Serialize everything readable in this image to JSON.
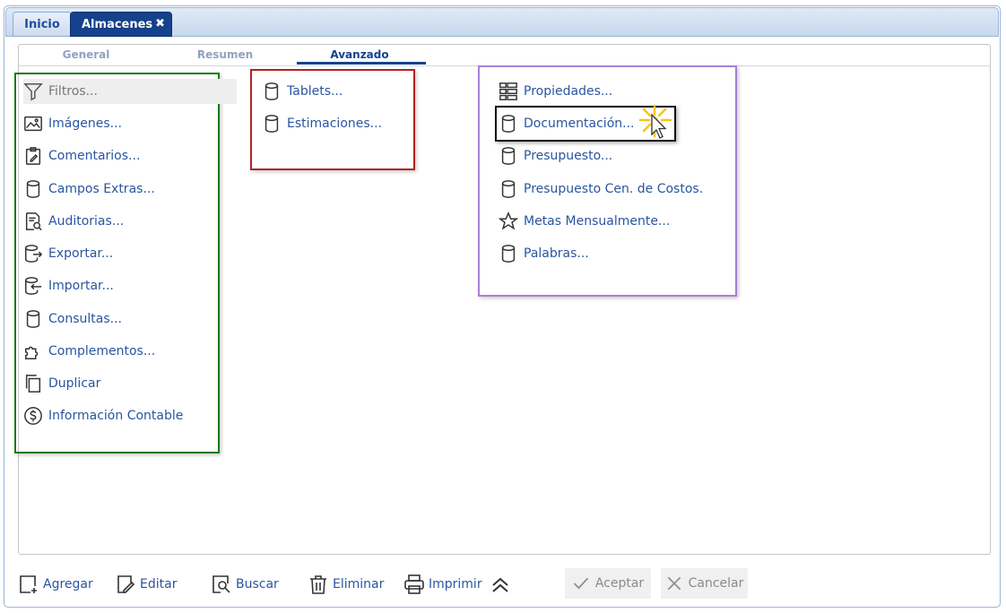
{
  "tabs": {
    "inicio": "Inicio",
    "almacenes": "Almacenes",
    "close_glyph": "✖"
  },
  "subtabs": [
    "General",
    "Resumen",
    "Avanzado"
  ],
  "active_subtab": "Avanzado",
  "col1": [
    {
      "label": "Filtros...",
      "icon": "filter-icon",
      "enabled": false
    },
    {
      "label": "Imágenes...",
      "icon": "image-icon",
      "enabled": true
    },
    {
      "label": "Comentarios...",
      "icon": "clipboard-edit-icon",
      "enabled": true
    },
    {
      "label": "Campos Extras...",
      "icon": "database-icon",
      "enabled": true
    },
    {
      "label": "Auditorias...",
      "icon": "document-search-icon",
      "enabled": true
    },
    {
      "label": "Exportar...",
      "icon": "database-export-icon",
      "enabled": true
    },
    {
      "label": "Importar...",
      "icon": "database-import-icon",
      "enabled": true
    },
    {
      "label": "Consultas...",
      "icon": "database-icon",
      "enabled": true
    },
    {
      "label": "Complementos...",
      "icon": "puzzle-icon",
      "enabled": true
    },
    {
      "label": "Duplicar",
      "icon": "copy-icon",
      "enabled": true
    },
    {
      "label": "Información Contable",
      "icon": "dollar-icon",
      "enabled": true
    }
  ],
  "col2": [
    {
      "label": "Tablets...",
      "icon": "database-icon"
    },
    {
      "label": "Estimaciones...",
      "icon": "database-icon"
    }
  ],
  "col3": [
    {
      "label": "Propiedades...",
      "icon": "properties-grid-icon"
    },
    {
      "label": "Documentación...",
      "icon": "database-icon"
    },
    {
      "label": "Presupuesto...",
      "icon": "database-icon"
    },
    {
      "label": "Presupuesto Cen. de Costos.",
      "icon": "database-icon"
    },
    {
      "label": "Metas Mensualmente...",
      "icon": "star-icon"
    },
    {
      "label": "Palabras...",
      "icon": "database-icon"
    }
  ],
  "toolbar": {
    "agregar": "Agregar",
    "editar": "Editar",
    "buscar": "Buscar",
    "eliminar": "Eliminar",
    "imprimir": "Imprimir",
    "aceptar": "Aceptar",
    "cancelar": "Cancelar"
  },
  "colors": {
    "accent": "#15428b",
    "link": "#2a55a0",
    "group_green": "#1a7a1a",
    "group_red": "#b22222",
    "group_purple": "#a77fd8"
  }
}
